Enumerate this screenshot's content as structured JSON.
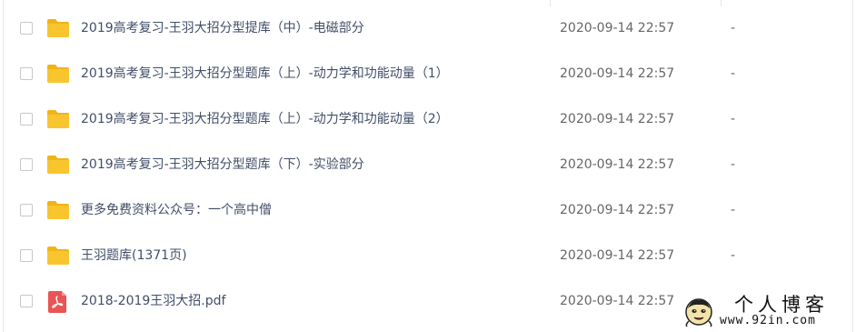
{
  "files": [
    {
      "name": "2019高考复习-王羽大招分型提库（中）-电磁部分",
      "date": "2020-09-14 22:57",
      "size": "-",
      "icon": "folder-icon"
    },
    {
      "name": "2019高考复习-王羽大招分型题库（上）-动力学和功能动量（1）",
      "date": "2020-09-14 22:57",
      "size": "-",
      "icon": "folder-icon"
    },
    {
      "name": "2019高考复习-王羽大招分型题库（上）-动力学和功能动量（2）",
      "date": "2020-09-14 22:57",
      "size": "-",
      "icon": "folder-icon"
    },
    {
      "name": "2019高考复习-王羽大招分型题库（下）-实验部分",
      "date": "2020-09-14 22:57",
      "size": "-",
      "icon": "folder-icon"
    },
    {
      "name": "更多免费资料公众号：一个高中僧",
      "date": "2020-09-14 22:57",
      "size": "-",
      "icon": "folder-icon"
    },
    {
      "name": "王羽题库(1371页)",
      "date": "2020-09-14 22:57",
      "size": "-",
      "icon": "folder-icon"
    },
    {
      "name": "2018-2019王羽大招.pdf",
      "date": "2020-09-14 22:57",
      "size": "",
      "icon": "pdf-icon"
    }
  ],
  "watermark": {
    "title": "个人博客",
    "url": "www.92in.com"
  },
  "colors": {
    "folder": "#f8c52f",
    "folder_tab": "#f0b418",
    "pdf": "#e95454",
    "link_text": "#424e67",
    "meta_text": "#666666",
    "checkbox_border": "#c8c8c8"
  }
}
